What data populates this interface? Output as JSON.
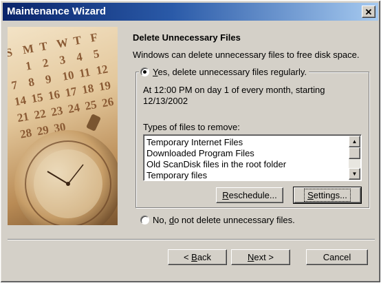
{
  "window": {
    "title": "Maintenance Wizard"
  },
  "page": {
    "heading": "Delete Unnecessary Files",
    "description": "Windows can delete unnecessary files to free disk space."
  },
  "options": {
    "yes": {
      "label_pre": "",
      "label_key": "Y",
      "label_post": "es, delete unnecessary files regularly.",
      "selected": true
    },
    "no": {
      "label_pre": "No, ",
      "label_key": "d",
      "label_post": "o not delete unnecessary files.",
      "selected": false
    }
  },
  "schedule": {
    "line1": "At 12:00 PM on day 1 of every month, starting",
    "line2": "12/13/2002"
  },
  "types": {
    "label": "Types of files to remove:",
    "items": [
      "Temporary Internet Files",
      "Downloaded Program Files",
      "Old ScanDisk files in the root folder",
      "Temporary files"
    ]
  },
  "buttons": {
    "reschedule": {
      "key": "R",
      "rest": "eschedule..."
    },
    "settings": {
      "key": "S",
      "rest": "ettings..."
    },
    "back": {
      "pre": "< ",
      "key": "B",
      "rest": "ack"
    },
    "next": {
      "key": "N",
      "rest": "ext >"
    },
    "cancel": "Cancel"
  },
  "calendar": {
    "rows": [
      [
        "S",
        "M",
        "T",
        "W",
        "T",
        "F"
      ],
      [
        "1",
        "2",
        "3",
        "4",
        "5"
      ],
      [
        "7",
        "8",
        "9",
        "10",
        "11",
        "12"
      ],
      [
        "14",
        "15",
        "16",
        "17",
        "18",
        "19"
      ],
      [
        "21",
        "22",
        "23",
        "24",
        "25",
        "26"
      ],
      [
        "28",
        "29",
        "30"
      ]
    ]
  },
  "icons": {
    "close": "close-icon",
    "scroll_up": "arrow-up-icon",
    "scroll_down": "arrow-down-icon"
  }
}
